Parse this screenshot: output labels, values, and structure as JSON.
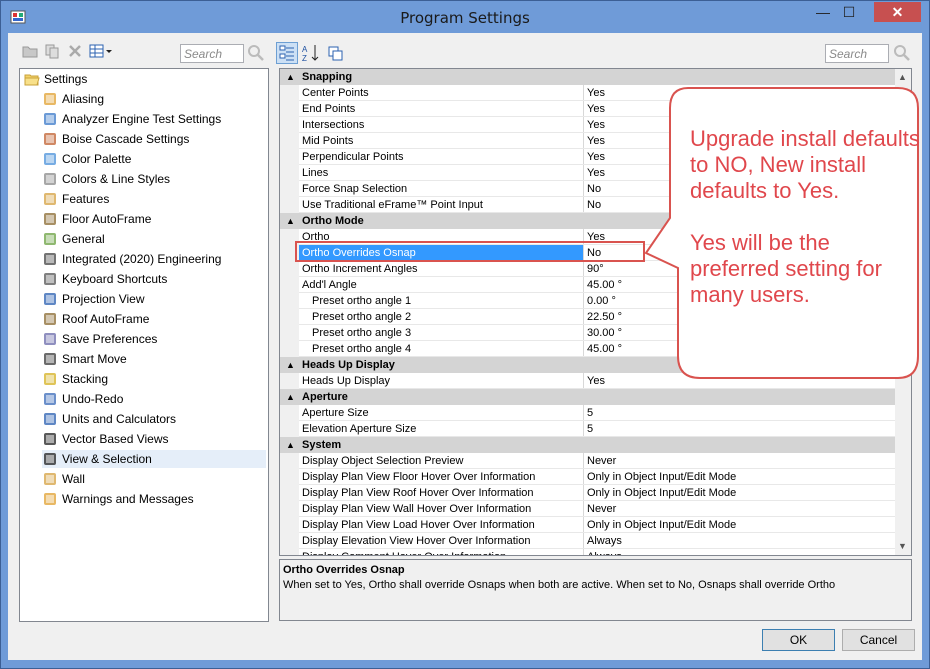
{
  "window": {
    "title": "Program Settings",
    "close_label": "✕",
    "min_label": "—",
    "max_label": "☐"
  },
  "left_search": {
    "placeholder": "Search"
  },
  "right_search": {
    "placeholder": "Search"
  },
  "tree": {
    "root": "Settings",
    "items": [
      "Aliasing",
      "Analyzer Engine Test Settings",
      "Boise Cascade Settings",
      "Color Palette",
      "Colors & Line Styles",
      "Features",
      "Floor AutoFrame",
      "General",
      "Integrated (2020) Engineering",
      "Keyboard Shortcuts",
      "Projection View",
      "Roof AutoFrame",
      "Save Preferences",
      "Smart Move",
      "Stacking",
      "Undo-Redo",
      "Units and Calculators",
      "Vector Based Views",
      "View & Selection",
      "Wall",
      "Warnings and Messages"
    ],
    "selected": "View & Selection"
  },
  "grid": {
    "rows": [
      {
        "type": "cat",
        "name": "Snapping"
      },
      {
        "type": "prop",
        "name": "Center Points",
        "value": "Yes"
      },
      {
        "type": "prop",
        "name": "End Points",
        "value": "Yes"
      },
      {
        "type": "prop",
        "name": "Intersections",
        "value": "Yes"
      },
      {
        "type": "prop",
        "name": "Mid Points",
        "value": "Yes"
      },
      {
        "type": "prop",
        "name": "Perpendicular Points",
        "value": "Yes"
      },
      {
        "type": "prop",
        "name": "Lines",
        "value": "Yes"
      },
      {
        "type": "prop",
        "name": "Force Snap Selection",
        "value": "No"
      },
      {
        "type": "prop",
        "name": "Use Traditional eFrame™ Point Input",
        "value": "No"
      },
      {
        "type": "cat",
        "name": "Ortho Mode"
      },
      {
        "type": "prop",
        "name": "Ortho",
        "value": "Yes"
      },
      {
        "type": "prop",
        "name": "Ortho Overrides Osnap",
        "value": "No",
        "selected": true
      },
      {
        "type": "prop",
        "name": "Ortho Increment Angles",
        "value": "90°"
      },
      {
        "type": "prop",
        "name": "Add'l Angle",
        "value": "45.00 °"
      },
      {
        "type": "sub",
        "name": "Preset ortho angle 1",
        "value": "0.00 °"
      },
      {
        "type": "sub",
        "name": "Preset ortho angle 2",
        "value": "22.50 °"
      },
      {
        "type": "sub",
        "name": "Preset ortho angle 3",
        "value": "30.00 °"
      },
      {
        "type": "sub",
        "name": "Preset ortho angle 4",
        "value": "45.00 °"
      },
      {
        "type": "cat",
        "name": "Heads Up Display"
      },
      {
        "type": "prop",
        "name": "Heads Up Display",
        "value": "Yes"
      },
      {
        "type": "cat",
        "name": "Aperture"
      },
      {
        "type": "prop",
        "name": "Aperture Size",
        "value": "5"
      },
      {
        "type": "prop",
        "name": "Elevation Aperture Size",
        "value": "5"
      },
      {
        "type": "cat",
        "name": "System"
      },
      {
        "type": "prop",
        "name": "Display Object Selection Preview",
        "value": "Never"
      },
      {
        "type": "prop",
        "name": "Display Plan View Floor Hover Over Information",
        "value": "Only in Object Input/Edit Mode"
      },
      {
        "type": "prop",
        "name": "Display Plan View Roof Hover Over Information",
        "value": "Only in Object Input/Edit Mode"
      },
      {
        "type": "prop",
        "name": "Display Plan View Wall Hover Over Information",
        "value": "Never"
      },
      {
        "type": "prop",
        "name": "Display Plan View Load Hover Over Information",
        "value": "Only in Object Input/Edit Mode"
      },
      {
        "type": "prop",
        "name": "Display Elevation View Hover Over Information",
        "value": "Always"
      },
      {
        "type": "prop",
        "name": "Display Comment Hover Over Information",
        "value": "Always"
      }
    ]
  },
  "description": {
    "title": "Ortho Overrides Osnap",
    "text": "When set to Yes, Ortho shall override Osnaps when both are active. When set to No, Osnaps shall override Ortho"
  },
  "buttons": {
    "ok": "OK",
    "cancel": "Cancel"
  },
  "callout": {
    "line1": "Upgrade install defaults to NO, New install defaults to Yes.",
    "line2": "Yes will be the preferred setting for many users.",
    "color": "#e0474c"
  },
  "icons": {
    "category_toggle": "▲",
    "scroll_up": "▲",
    "scroll_down": "▼"
  }
}
